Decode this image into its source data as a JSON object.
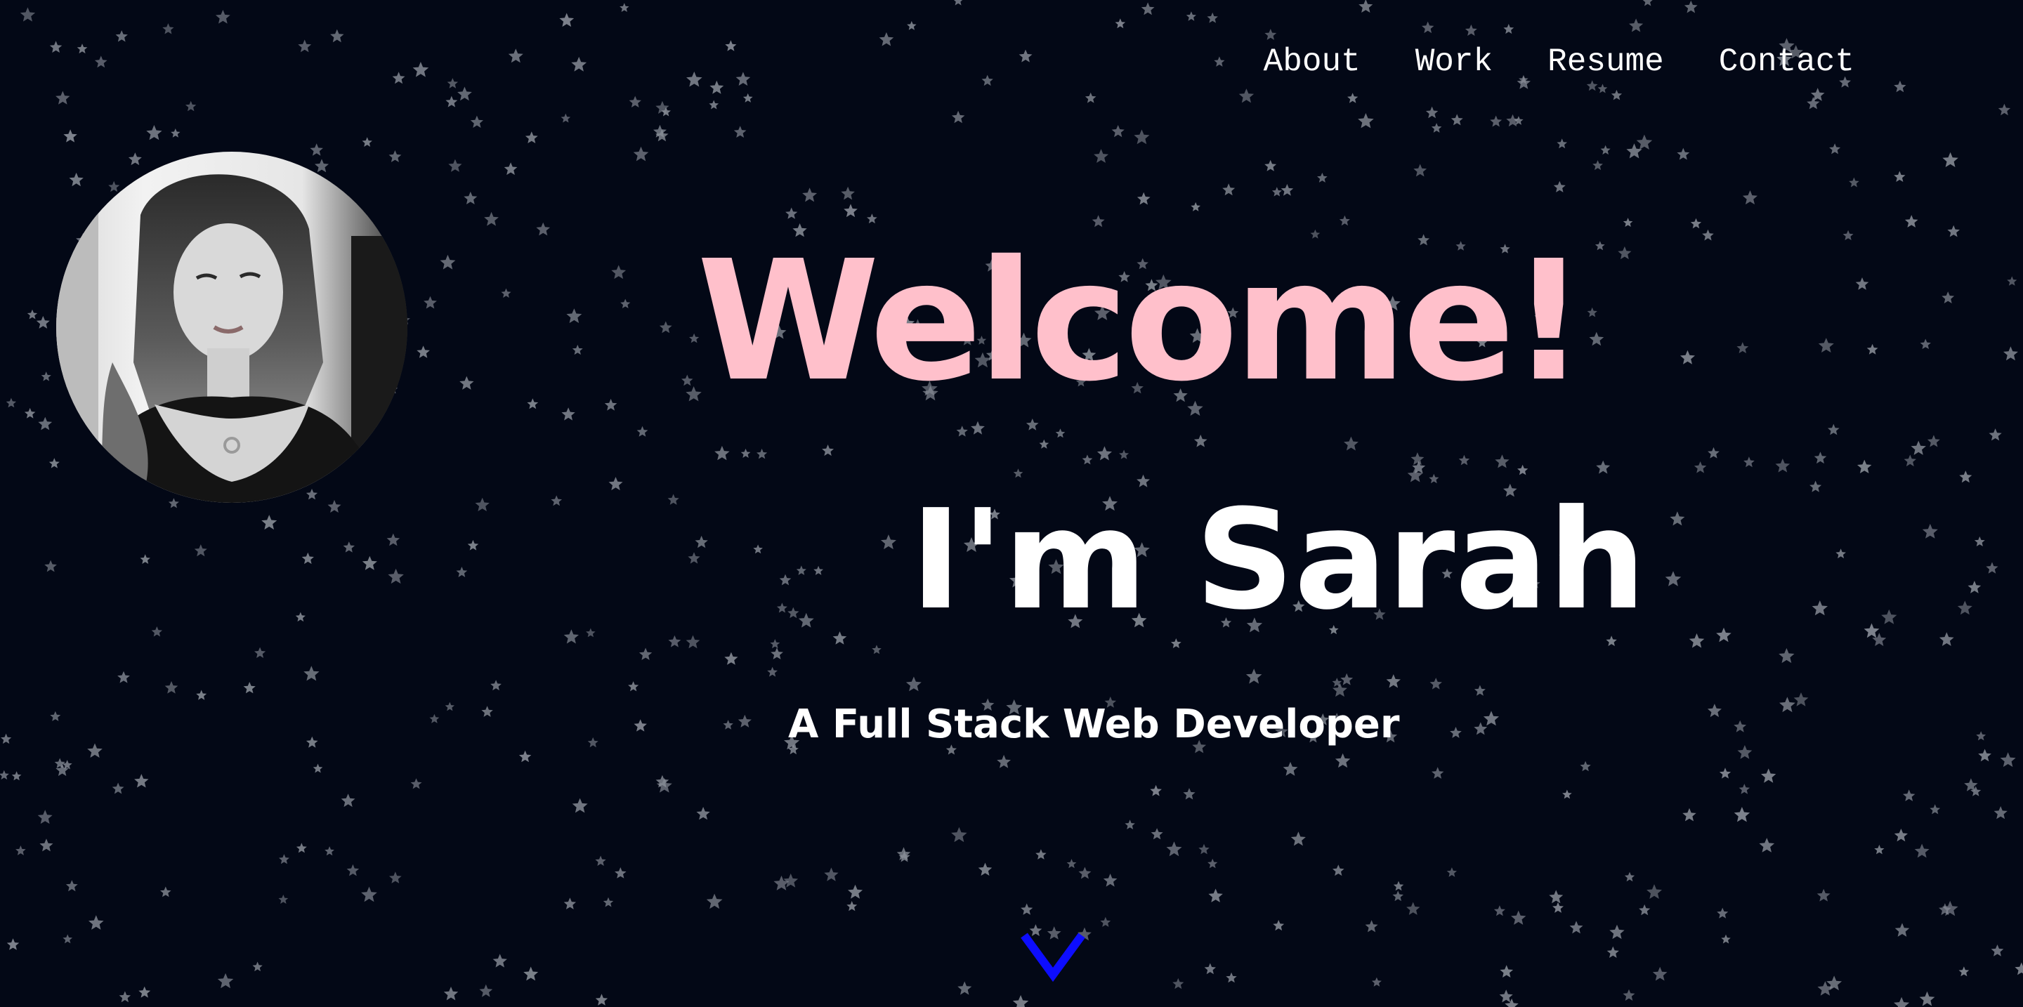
{
  "nav": {
    "items": [
      {
        "label": "About"
      },
      {
        "label": "Work"
      },
      {
        "label": "Resume"
      },
      {
        "label": "Contact"
      }
    ]
  },
  "hero": {
    "welcome": "Welcome!",
    "name": "I'm Sarah",
    "tagline": "A Full Stack Web Developer",
    "avatar_icon": "profile-photo"
  },
  "scroll_indicator": {
    "icon": "chevron-down-icon"
  },
  "colors": {
    "background": "#030816",
    "welcome": "#ffc0cb",
    "text": "#ffffff",
    "star": "#8a8f99",
    "chevron": "#0d0dff"
  }
}
